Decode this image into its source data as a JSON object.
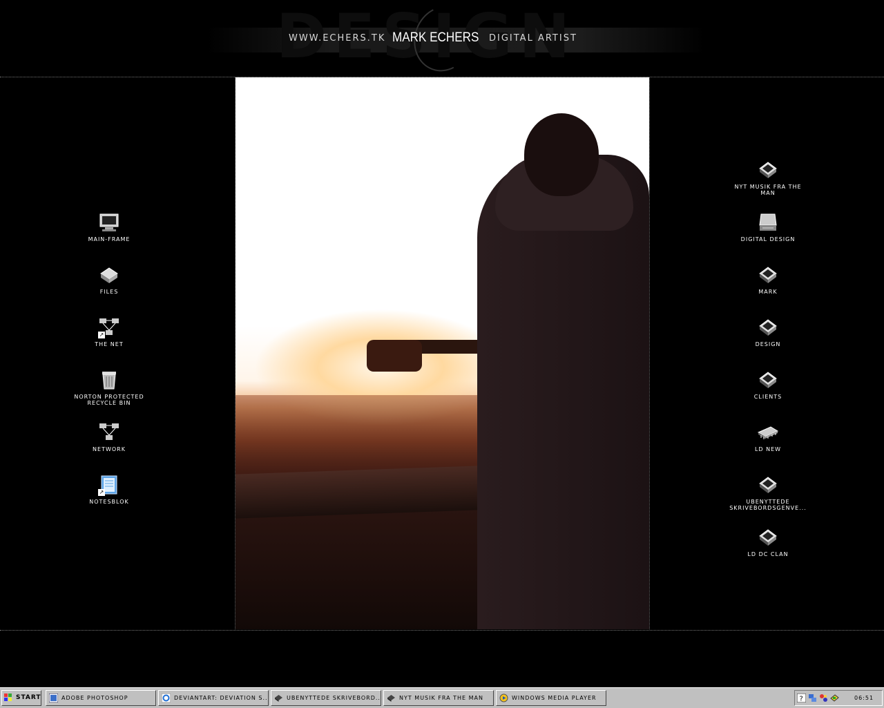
{
  "header": {
    "background_word": "DESIGN",
    "site_url": "www.echers.tk",
    "name": "MARK ECHERS",
    "role": "Digital artist"
  },
  "desktop": {
    "left_icons": [
      {
        "label": "main-frame",
        "icon": "monitor-icon"
      },
      {
        "label": "files",
        "icon": "drive-icon"
      },
      {
        "label": "the net",
        "icon": "network-icon",
        "shortcut": true
      },
      {
        "label": "norton protected recycle bin",
        "icon": "recycle-bin-icon"
      },
      {
        "label": "network",
        "icon": "network-icon"
      },
      {
        "label": "notesblok",
        "icon": "notepad-icon",
        "shortcut": true
      }
    ],
    "right_icons": [
      {
        "label": "nyt musik fra the man",
        "icon": "folder-icon"
      },
      {
        "label": "digital design",
        "icon": "drive-icon"
      },
      {
        "label": "mark",
        "icon": "folder-icon"
      },
      {
        "label": "design",
        "icon": "folder-icon"
      },
      {
        "label": "clients",
        "icon": "folder-icon"
      },
      {
        "label": "LD new",
        "icon": "chip-icon"
      },
      {
        "label": "ubenyttede skrivebordsgenve...",
        "icon": "folder-icon"
      },
      {
        "label": "LD DC clan",
        "icon": "folder-icon"
      }
    ]
  },
  "taskbar": {
    "start_label": "START",
    "tasks": [
      {
        "label": "ADOBE PHOTOSHOP"
      },
      {
        "label": "DEVIANTART: DEVIATION S..."
      },
      {
        "label": "UBENYTTEDE SKRIVEBORD..."
      },
      {
        "label": "NYT MUSIK FRA THE MAN"
      },
      {
        "label": "WINDOWS MEDIA PLAYER"
      }
    ],
    "clock": "06:51"
  },
  "colors": {
    "desktop_bg": "#000000",
    "taskbar_bg": "#c0c0c0",
    "label_text": "#ffffff"
  }
}
